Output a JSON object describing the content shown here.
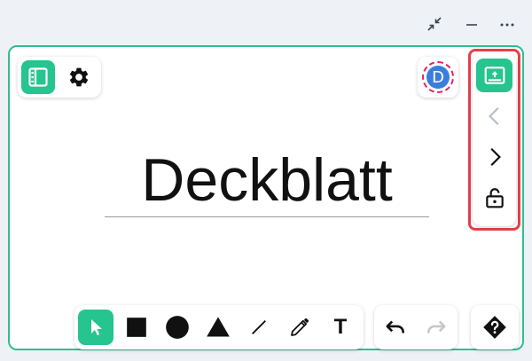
{
  "window_controls": {
    "icons": [
      "collapse-arrows-icon",
      "minimize-icon",
      "more-options-icon"
    ]
  },
  "slide": {
    "title": "Deckblatt"
  },
  "avatar": {
    "initial": "D",
    "color": "#3b7ddd",
    "ring_color": "#e0245e"
  },
  "top_left_toolbar": {
    "icons": [
      "slide-panel-icon",
      "gear-icon"
    ],
    "active": "slide-panel-icon"
  },
  "slide_navigation": {
    "icons": [
      "present-icon",
      "chevron-left-icon",
      "chevron-right-icon",
      "lock-open-icon"
    ],
    "previous_disabled": true
  },
  "drawing_tools": {
    "icons": [
      "pointer-icon",
      "rectangle-icon",
      "circle-icon",
      "triangle-icon",
      "line-icon",
      "pencil-icon",
      "text-icon"
    ],
    "active": "pointer-icon",
    "text_tool_glyph": "T"
  },
  "history": {
    "icons": [
      "undo-icon",
      "redo-icon"
    ],
    "redo_disabled": true
  },
  "help": {
    "icon": "help-diamond-icon"
  },
  "colors": {
    "accent": "#26c48f",
    "board_border": "#2fbf8f",
    "highlight": "#e5404a",
    "background": "#eef2f6"
  }
}
